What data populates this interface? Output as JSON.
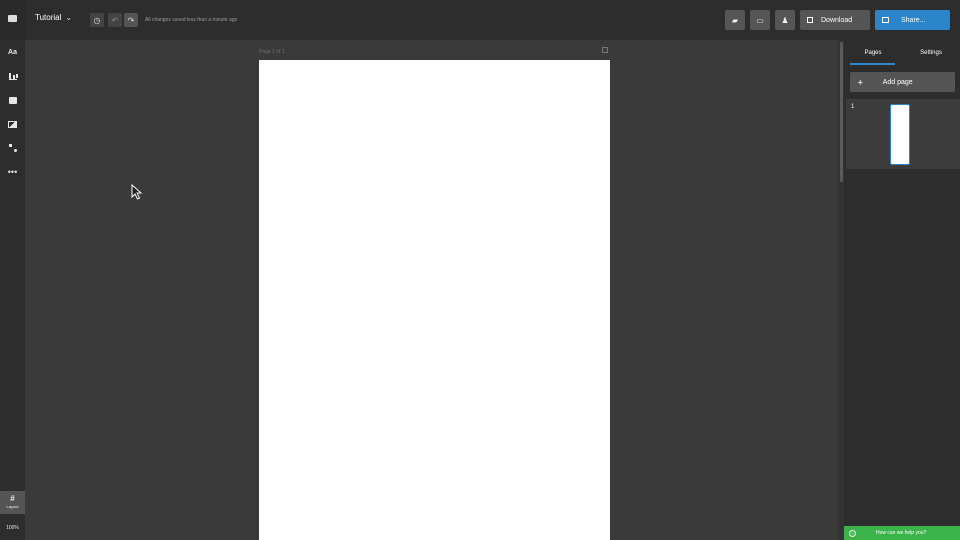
{
  "header": {
    "doc_title": "Tutorial",
    "save_status": "All changes saved less than a minute ago",
    "download_label": "Download",
    "share_label": "Share..."
  },
  "sidebar": {
    "text_tool_label": "Aa",
    "more_label": "•••",
    "layout_hash": "#",
    "layout_label": "Layout",
    "zoom_label": "100%"
  },
  "canvas": {
    "page_label": "Page 1 of 1"
  },
  "right_panel": {
    "tabs": [
      "Pages",
      "Settings"
    ],
    "add_page_plus": "+",
    "add_page_label": "Add page",
    "pages": [
      {
        "number": "1"
      }
    ],
    "help_text": "How can we help you?",
    "help_icon": "?"
  },
  "colors": {
    "accent": "#2a86c9",
    "help_green": "#3ab44a",
    "topbar_bg": "#2d2d2d",
    "canvas_bg": "#3a3a3a"
  },
  "icons": [
    "logo-icon",
    "chevron-down-icon",
    "history-icon",
    "undo-icon",
    "redo-icon",
    "comment-icon",
    "presentation-icon",
    "collaborators-icon",
    "download-icon",
    "share-icon",
    "text-icon",
    "charts-icon",
    "media-icon",
    "photos-icon",
    "shapes-icon",
    "more-icon",
    "grid-icon",
    "copy-icon",
    "help-icon"
  ]
}
